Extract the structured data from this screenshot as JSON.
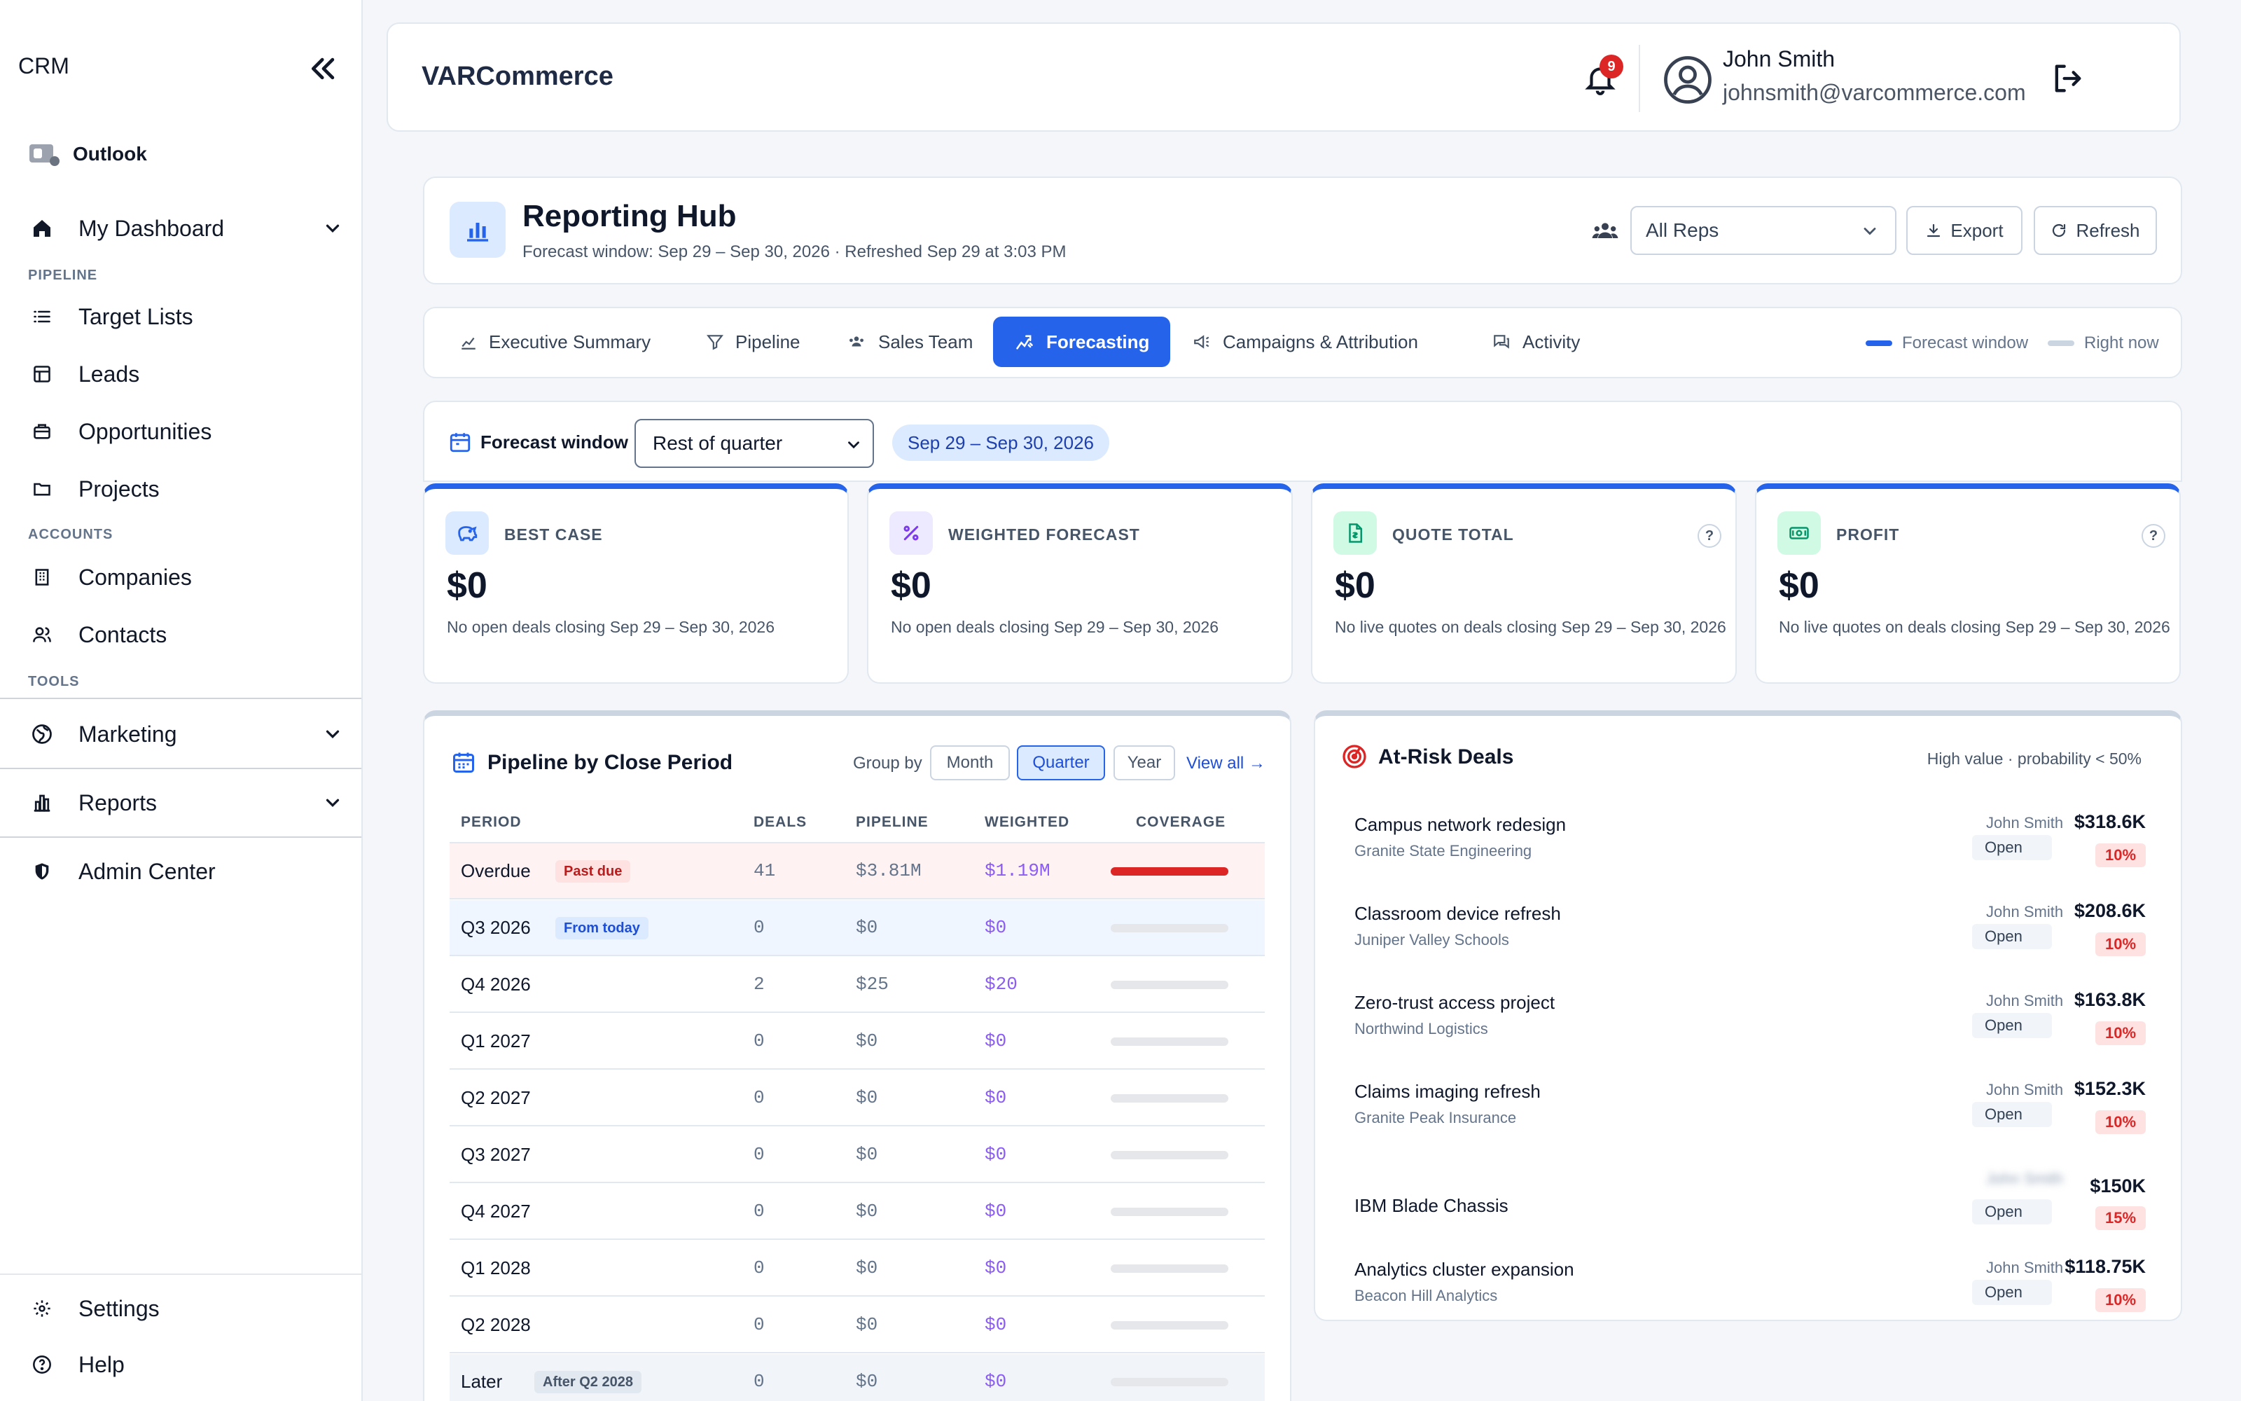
{
  "sidebar": {
    "brand": "CRM",
    "outlook": "Outlook",
    "my_dashboard": "My Dashboard",
    "sections": {
      "pipeline": "PIPELINE",
      "accounts": "ACCOUNTS",
      "tools": "TOOLS"
    },
    "target_lists": "Target Lists",
    "leads": "Leads",
    "opportunities": "Opportunities",
    "projects": "Projects",
    "companies": "Companies",
    "contacts": "Contacts",
    "marketing": "Marketing",
    "reports": "Reports",
    "admin_center": "Admin Center",
    "settings": "Settings",
    "help": "Help"
  },
  "header": {
    "title": "VARCommerce",
    "notification_count": "9",
    "user_name": "John Smith",
    "user_email": "johnsmith@varcommerce.com"
  },
  "hub": {
    "title": "Reporting Hub",
    "subtitle": "Forecast window: Sep 29 – Sep 30, 2026  ·  Refreshed Sep 29 at 3:03 PM",
    "reps_select": "All Reps",
    "export": "Export",
    "refresh": "Refresh"
  },
  "tabs": [
    {
      "label": "Executive Summary"
    },
    {
      "label": "Pipeline"
    },
    {
      "label": "Sales Team"
    },
    {
      "label": "Forecasting"
    },
    {
      "label": "Campaigns & Attribution"
    },
    {
      "label": "Activity"
    }
  ],
  "legend": {
    "forecast": "Forecast window",
    "now": "Right now"
  },
  "forecast_window": {
    "label": "Forecast window",
    "select": "Rest of quarter",
    "range": "Sep 29 – Sep 30, 2026"
  },
  "kpis": [
    {
      "label": "BEST CASE",
      "value": "$0",
      "note": "No open deals closing Sep 29 – Sep 30, 2026"
    },
    {
      "label": "WEIGHTED FORECAST",
      "value": "$0",
      "note": "No open deals closing Sep 29 – Sep 30, 2026"
    },
    {
      "label": "QUOTE TOTAL",
      "value": "$0",
      "note": "No live quotes on deals closing Sep 29 – Sep 30, 2026",
      "help": "?"
    },
    {
      "label": "PROFIT",
      "value": "$0",
      "note": "No live quotes on deals closing Sep 29 – Sep 30, 2026",
      "help": "?"
    }
  ],
  "pipeline": {
    "title": "Pipeline by Close Period",
    "group_by": "Group by",
    "groups": [
      "Month",
      "Quarter",
      "Year"
    ],
    "view_all": "View all →",
    "columns": [
      "PERIOD",
      "DEALS",
      "PIPELINE",
      "WEIGHTED",
      "COVERAGE"
    ],
    "rows": [
      {
        "period": "Overdue",
        "tag": "Past due",
        "deals": "41",
        "pipeline": "$3.81M",
        "weighted": "$1.19M",
        "coverage": 1.0
      },
      {
        "period": "Q3 2026",
        "tag": "From today",
        "deals": "0",
        "pipeline": "$0",
        "weighted": "$0",
        "coverage": 0
      },
      {
        "period": "Q4 2026",
        "tag": "",
        "deals": "2",
        "pipeline": "$25",
        "weighted": "$20",
        "coverage": 0
      },
      {
        "period": "Q1 2027",
        "tag": "",
        "deals": "0",
        "pipeline": "$0",
        "weighted": "$0",
        "coverage": 0
      },
      {
        "period": "Q2 2027",
        "tag": "",
        "deals": "0",
        "pipeline": "$0",
        "weighted": "$0",
        "coverage": 0
      },
      {
        "period": "Q3 2027",
        "tag": "",
        "deals": "0",
        "pipeline": "$0",
        "weighted": "$0",
        "coverage": 0
      },
      {
        "period": "Q4 2027",
        "tag": "",
        "deals": "0",
        "pipeline": "$0",
        "weighted": "$0",
        "coverage": 0
      },
      {
        "period": "Q1 2028",
        "tag": "",
        "deals": "0",
        "pipeline": "$0",
        "weighted": "$0",
        "coverage": 0
      },
      {
        "period": "Q2 2028",
        "tag": "",
        "deals": "0",
        "pipeline": "$0",
        "weighted": "$0",
        "coverage": 0
      },
      {
        "period": "Later",
        "tag": "After Q2 2028",
        "deals": "0",
        "pipeline": "$0",
        "weighted": "$0",
        "coverage": 0
      }
    ]
  },
  "at_risk": {
    "title": "At-Risk Deals",
    "subtitle": "High value · probability < 50%",
    "deals": [
      {
        "name": "Campus network redesign",
        "company": "Granite State Engineering",
        "owner": "John Smith",
        "status": "Open",
        "amount": "$318.6K",
        "probability": "10%"
      },
      {
        "name": "Classroom device refresh",
        "company": "Juniper Valley Schools",
        "owner": "John Smith",
        "status": "Open",
        "amount": "$208.6K",
        "probability": "10%"
      },
      {
        "name": "Zero-trust access project",
        "company": "Northwind Logistics",
        "owner": "John Smith",
        "status": "Open",
        "amount": "$163.8K",
        "probability": "10%"
      },
      {
        "name": "Claims imaging refresh",
        "company": "Granite Peak Insurance",
        "owner": "John Smith",
        "status": "Open",
        "amount": "$152.3K",
        "probability": "10%"
      },
      {
        "name": "IBM Blade Chassis",
        "company": "",
        "owner": "John Smith",
        "status": "Open",
        "amount": "$150K",
        "probability": "15%"
      },
      {
        "name": "Analytics cluster expansion",
        "company": "Beacon Hill Analytics",
        "owner": "John Smith",
        "status": "Open",
        "amount": "$118.75K",
        "probability": "10%"
      }
    ]
  },
  "colors": {
    "accent": "#2563eb",
    "danger": "#dc2626",
    "weighted": "#8b5cf6"
  }
}
